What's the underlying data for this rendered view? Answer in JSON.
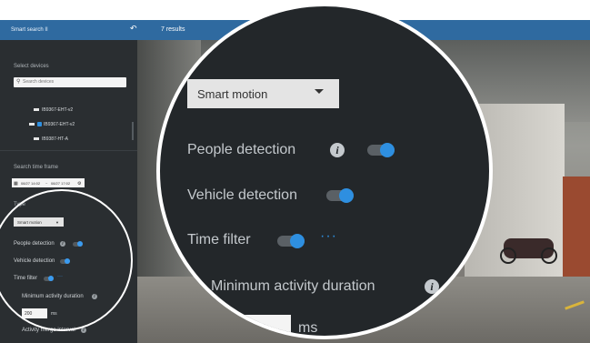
{
  "header": {
    "app_title": "Smart search II",
    "results": "7 results",
    "back_icon": "back-arrow-icon"
  },
  "sidebar": {
    "select_devices_label": "Select devices",
    "search_placeholder": "Search devices",
    "devices": [
      {
        "name": "IB9367-EHT-v2",
        "checked": false
      },
      {
        "name": "IB9367-EHT-v2",
        "checked": true
      },
      {
        "name": "IB9387-HT-A",
        "checked": false
      }
    ],
    "time_frame_label": "Search time frame",
    "date_from": "08/27 14:02",
    "date_sep": "~",
    "date_to": "08/27 17:02",
    "type_label": "Type",
    "type_value": "Smart motion",
    "people_detection": "People detection",
    "vehicle_detection": "Vehicle detection",
    "time_filter": "Time filter",
    "more": "···",
    "min_duration": "Minimum activity duration",
    "min_duration_value": "200",
    "ms": "ms",
    "merge_interval": "Activity merge interval"
  },
  "zoom": {
    "type_value": "Smart motion",
    "people_detection": "People detection",
    "vehicle_detection": "Vehicle detection",
    "time_filter": "Time filter",
    "more": "···",
    "min_duration": "Minimum activity duration",
    "ms": "ms"
  },
  "colors": {
    "header_blue": "#2f6aa0",
    "sidebar_bg": "#2a2e31",
    "toggle_on": "#2e8fe0"
  }
}
